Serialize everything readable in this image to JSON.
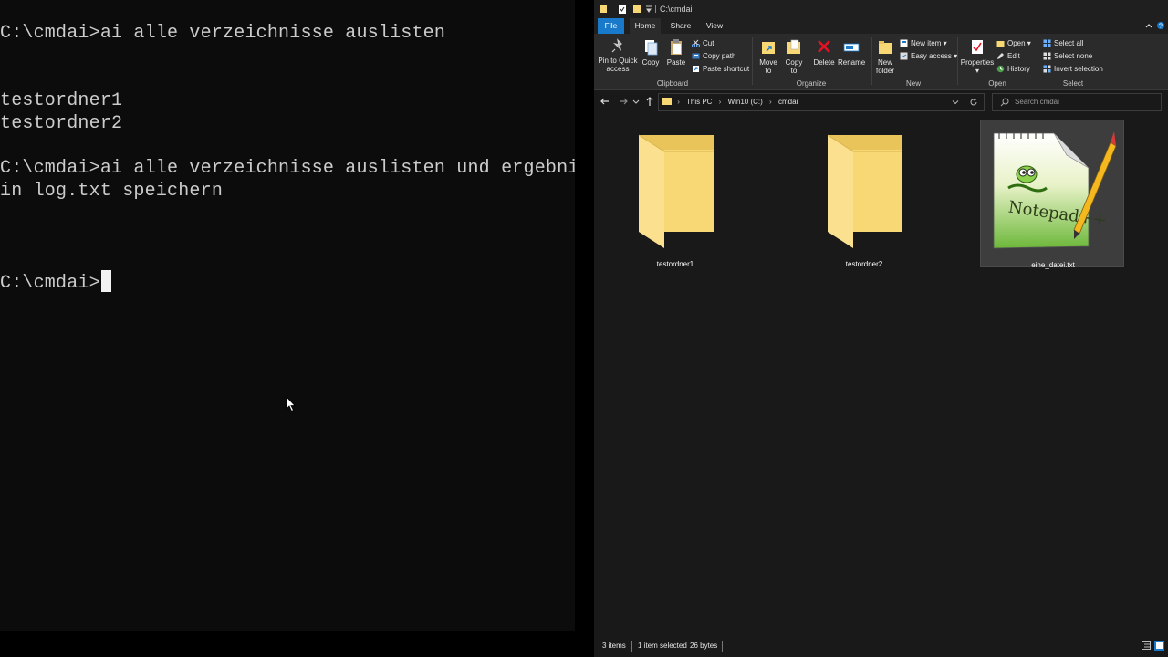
{
  "terminal": {
    "lines": [
      "C:\\cmdai>ai alle verzeichnisse auslisten",
      "testordner1",
      "testordner2",
      "C:\\cmdai>ai alle verzeichnisse auslisten und ergebnis",
      "in log.txt speichern",
      "C:\\cmdai>"
    ]
  },
  "explorer": {
    "title": "C:\\cmdai",
    "tabs": {
      "file": "File",
      "home": "Home",
      "share": "Share",
      "view": "View"
    },
    "ribbon": {
      "pin_to_quick_access": [
        "Pin to Quick",
        "access"
      ],
      "copy": "Copy",
      "paste": "Paste",
      "cut": "Cut",
      "copy_path": "Copy path",
      "paste_shortcut": "Paste shortcut",
      "move_to": [
        "Move",
        "to"
      ],
      "copy_to": [
        "Copy",
        "to"
      ],
      "delete": "Delete",
      "rename": "Rename",
      "new_folder": [
        "New",
        "folder"
      ],
      "new_item": "New item",
      "easy_access": "Easy access",
      "properties": "Properties",
      "open": "Open",
      "edit": "Edit",
      "history": "History",
      "select_all": "Select all",
      "select_none": "Select none",
      "invert_selection": "Invert selection",
      "groups": {
        "clipboard": "Clipboard",
        "organize": "Organize",
        "new": "New",
        "open": "Open",
        "select": "Select"
      }
    },
    "address": {
      "crumbs": [
        "This PC",
        "Win10 (C:)",
        "cmdai"
      ]
    },
    "search": {
      "placeholder": "Search cmdai"
    },
    "items": [
      {
        "name": "testordner1",
        "type": "folder",
        "selected": false
      },
      {
        "name": "testordner2",
        "type": "folder",
        "selected": false
      },
      {
        "name": "eine_datei.txt",
        "type": "notepad-plus-plus-file",
        "selected": true
      }
    ],
    "status": {
      "items": "3 items",
      "selected": "1 item selected",
      "size": "26 bytes"
    },
    "colors": {
      "file_tab": "#1979ca",
      "background": "#191919",
      "ribbon": "#2b2b2b",
      "folder": "#f8d775"
    }
  }
}
